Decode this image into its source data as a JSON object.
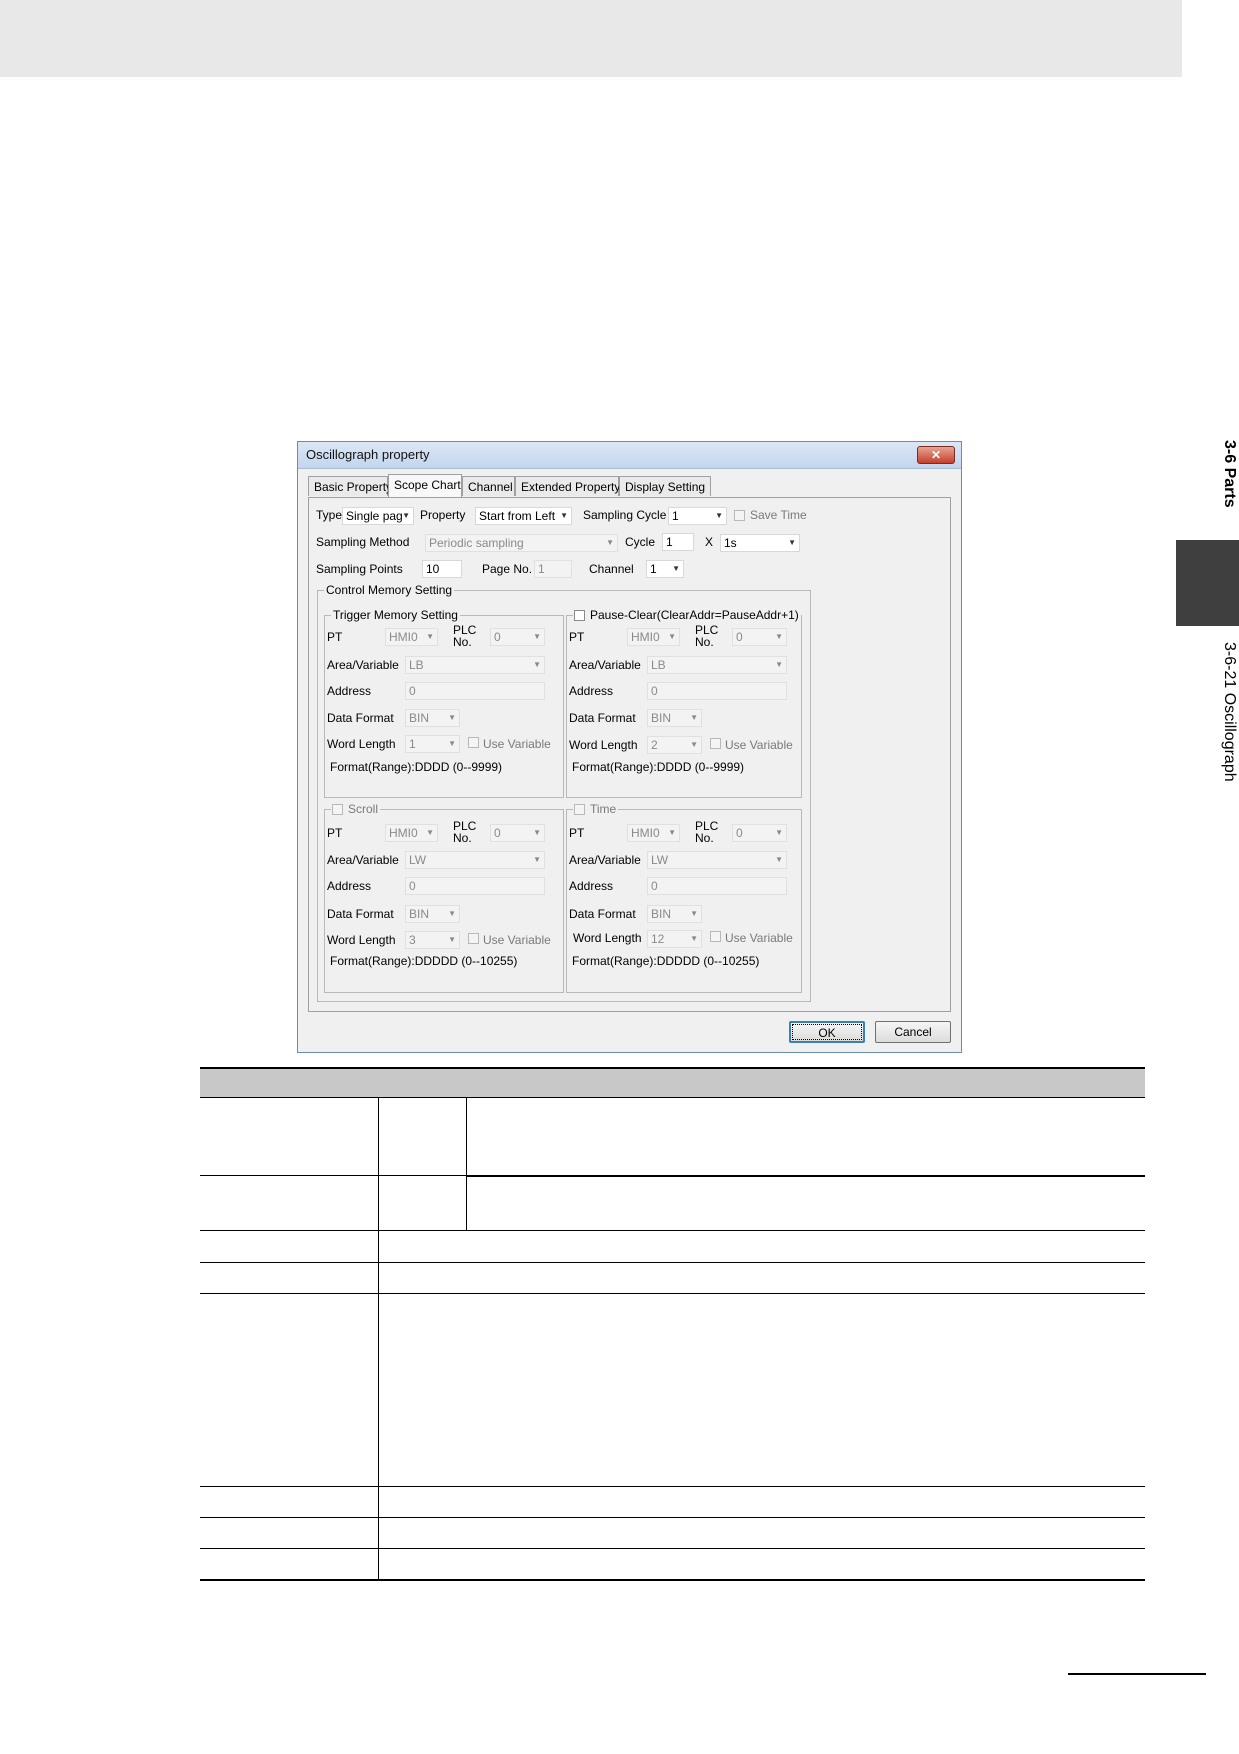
{
  "side": {
    "section": "3-6 Parts",
    "subsection": "3-6-21  Oscillograph"
  },
  "dialog": {
    "title": "Oscillograph property",
    "close_label": "✕",
    "tabs": [
      "Basic Property",
      "Scope Chart",
      "Channel",
      "Extended Property",
      "Display Setting"
    ],
    "active_tab": "Scope Chart",
    "type_label": "Type",
    "type_value": "Single pag",
    "property_label": "Property",
    "property_value": "Start from Left",
    "sampling_cycle_label": "Sampling Cycle",
    "sampling_cycle_value": "1",
    "save_time_label": "Save Time",
    "sampling_method_label": "Sampling Method",
    "sampling_method_value": "Periodic sampling",
    "cycle_label": "Cycle",
    "cycle_value": "1",
    "x_label": "X",
    "cycle_unit_value": "1s",
    "sampling_points_label": "Sampling Points",
    "sampling_points_value": "10",
    "page_no_label": "Page No.",
    "page_no_value": "1",
    "channel_label": "Channel",
    "channel_value": "1",
    "control_memory_title": "Control Memory Setting",
    "trigger": {
      "title": "Trigger Memory Setting",
      "pt_label": "PT",
      "pt_value": "HMI0",
      "plc_label": "PLC\nNo.",
      "plc_value": "0",
      "area_label": "Area/Variable",
      "area_value": "LB",
      "address_label": "Address",
      "address_value": "0",
      "format_label": "Data Format",
      "format_value": "BIN",
      "word_length_label": "Word Length",
      "word_length_value": "1",
      "use_variable_label": "Use Variable",
      "range": "Format(Range):DDDD (0--9999)"
    },
    "pause": {
      "title": "Pause-Clear(ClearAddr=PauseAddr+1)",
      "pt_label": "PT",
      "pt_value": "HMI0",
      "plc_label": "PLC\nNo.",
      "plc_value": "0",
      "area_label": "Area/Variable",
      "area_value": "LB",
      "address_label": "Address",
      "address_value": "0",
      "format_label": "Data Format",
      "format_value": "BIN",
      "word_length_label": "Word Length",
      "word_length_value": "2",
      "use_variable_label": "Use Variable",
      "range": "Format(Range):DDDD (0--9999)"
    },
    "scroll": {
      "title": "Scroll",
      "pt_label": "PT",
      "pt_value": "HMI0",
      "plc_label": "PLC\nNo.",
      "plc_value": "0",
      "area_label": "Area/Variable",
      "area_value": "LW",
      "address_label": "Address",
      "address_value": "0",
      "format_label": "Data Format",
      "format_value": "BIN",
      "word_length_label": "Word Length",
      "word_length_value": "3",
      "use_variable_label": "Use Variable",
      "range": "Format(Range):DDDDD (0--10255)"
    },
    "time": {
      "title": "Time",
      "pt_label": "PT",
      "pt_value": "HMI0",
      "plc_label": "PLC\nNo.",
      "plc_value": "0",
      "area_label": "Area/Variable",
      "area_value": "LW",
      "address_label": "Address",
      "address_value": "0",
      "format_label": "Data Format",
      "format_value": "BIN",
      "word_length_label": "Word Length",
      "word_length_value": "12",
      "use_variable_label": "Use Variable",
      "range": "Format(Range):DDDDD (0--10255)"
    },
    "ok_label": "OK",
    "cancel_label": "Cancel"
  }
}
